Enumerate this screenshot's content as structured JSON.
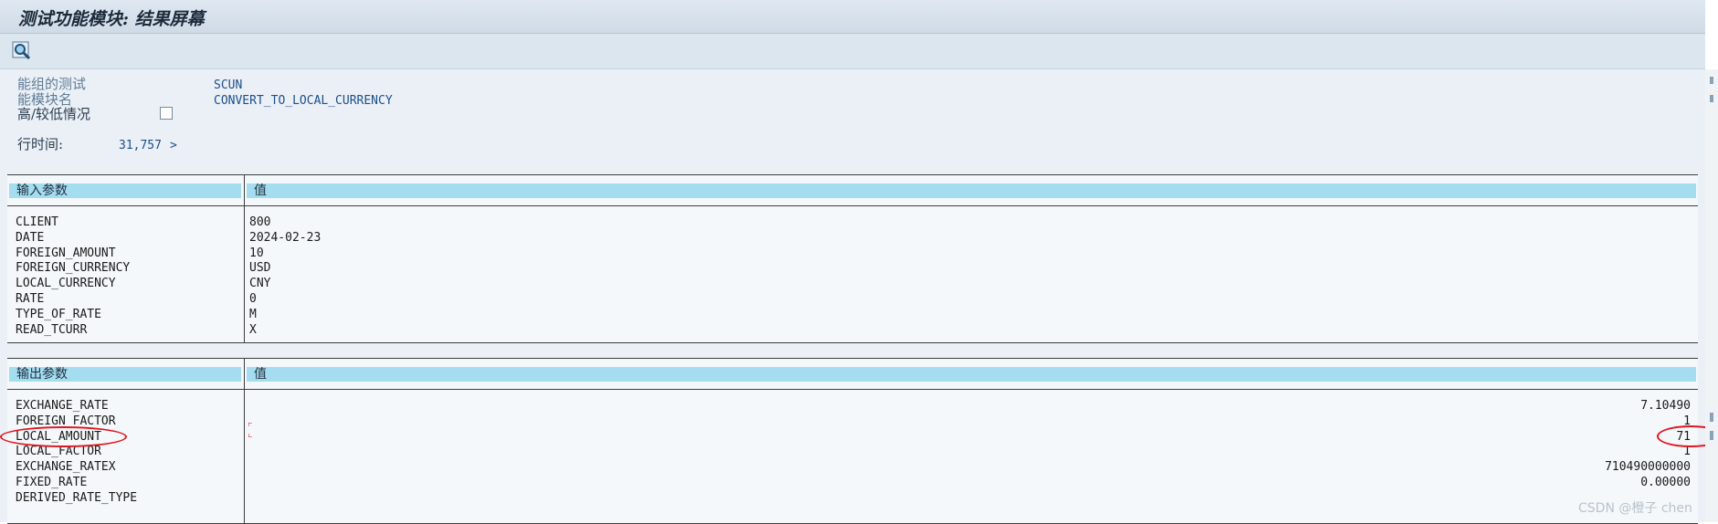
{
  "window": {
    "title": "测试功能模块: 结果屏幕"
  },
  "toolbar": {
    "icon": "magnify-icon"
  },
  "info": {
    "test_label": "能组的测试",
    "test_value": "SCUN",
    "module_label": "能模块名",
    "module_value": "CONVERT_TO_LOCAL_CURRENCY",
    "upper_lower_label": "高/较低情况",
    "runtime_label": "行时间:",
    "runtime_value": "31,757",
    "runtime_arrow": ">"
  },
  "import_table": {
    "header_name": "输入参数",
    "header_value": "值",
    "rows": [
      {
        "name": "CLIENT",
        "value": "800"
      },
      {
        "name": "DATE",
        "value": "2024-02-23"
      },
      {
        "name": "FOREIGN_AMOUNT",
        "value": "10"
      },
      {
        "name": "FOREIGN_CURRENCY",
        "value": "USD"
      },
      {
        "name": "LOCAL_CURRENCY",
        "value": "CNY"
      },
      {
        "name": "RATE",
        "value": "0"
      },
      {
        "name": "TYPE_OF_RATE",
        "value": "M"
      },
      {
        "name": "READ_TCURR",
        "value": "X"
      }
    ]
  },
  "export_table": {
    "header_name": "输出参数",
    "header_value": "值",
    "rows": [
      {
        "name": "EXCHANGE_RATE",
        "value": "7.10490"
      },
      {
        "name": "FOREIGN_FACTOR",
        "value": "1"
      },
      {
        "name": "LOCAL_AMOUNT",
        "value": "71"
      },
      {
        "name": "LOCAL_FACTOR",
        "value": "1"
      },
      {
        "name": "EXCHANGE_RATEX",
        "value": "710490000000"
      },
      {
        "name": "FIXED_RATE",
        "value": "0.00000"
      },
      {
        "name": "DERIVED_RATE_TYPE",
        "value": ""
      }
    ]
  },
  "watermark": "CSDN @橙子 chen",
  "colors": {
    "highlight": "#e0141e",
    "header_bg": "#a4ddf0"
  }
}
